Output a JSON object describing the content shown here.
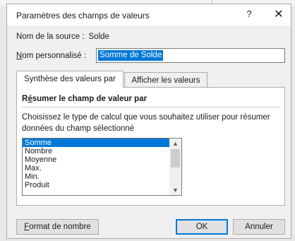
{
  "dialog": {
    "title": "Paramètres des champs de valeurs",
    "help_glyph": "?",
    "close_glyph": "✕"
  },
  "source": {
    "label": "Nom de la source :",
    "value": "Solde"
  },
  "custom_name": {
    "label_first": "N",
    "label_rest": "om personnalisé :",
    "value": "Somme de Solde"
  },
  "tabs": [
    {
      "label": "Synthèse des valeurs par",
      "active": true
    },
    {
      "label": "Afficher les valeurs",
      "active": false
    }
  ],
  "summarize": {
    "title_first": "R",
    "title_underlined": "é",
    "title_rest": "sumer le champ de valeur par",
    "description": "Choisissez le type de calcul que vous souhaitez utiliser pour résumer données du champ sélectionné",
    "options": [
      "Somme",
      "Nombre",
      "Moyenne",
      "Max.",
      "Min.",
      "Produit"
    ],
    "selected": "Somme",
    "scroll_up_glyph": "▲",
    "scroll_down_glyph": "▼"
  },
  "buttons": {
    "format_first": "F",
    "format_rest": "ormat de nombre",
    "ok": "OK",
    "cancel": "Annuler"
  },
  "colors": {
    "selection": "#0078d7",
    "dialog_bg": "#f0f0f0"
  }
}
